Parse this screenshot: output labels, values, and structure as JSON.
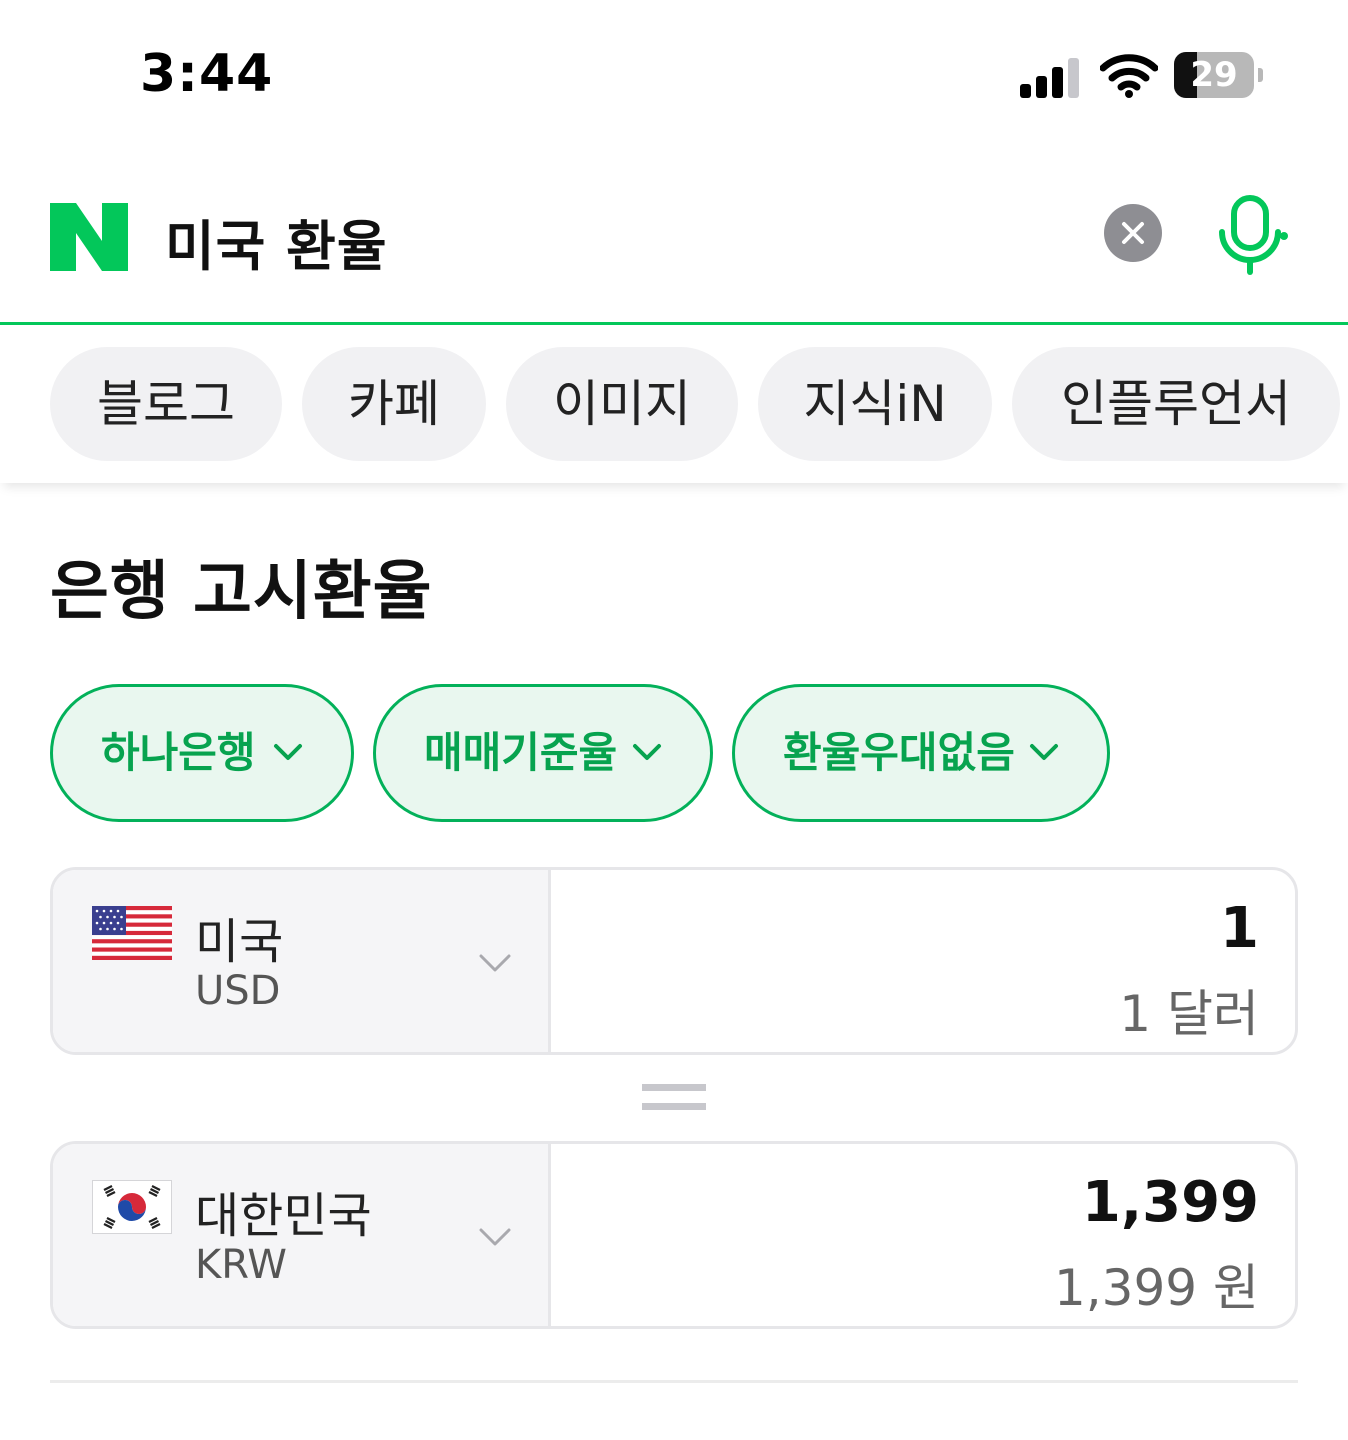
{
  "status_bar": {
    "time": "3:44",
    "battery_level": "29",
    "battery_fraction": 0.29,
    "signal_icon": "cellular-signal-icon",
    "wifi_icon": "wifi-icon"
  },
  "search": {
    "logo": "N",
    "query": "미국 환율",
    "clear_icon": "close-icon",
    "mic_icon": "microphone-icon"
  },
  "tabs": [
    {
      "label": "블로그"
    },
    {
      "label": "카페"
    },
    {
      "label": "이미지"
    },
    {
      "label": "지식iN"
    },
    {
      "label": "인플루언서"
    }
  ],
  "section": {
    "title": "은행 고시환율"
  },
  "filters": [
    {
      "label": "하나은행"
    },
    {
      "label": "매매기준율"
    },
    {
      "label": "환율우대없음"
    }
  ],
  "converter": {
    "from": {
      "country": "미국",
      "code": "USD",
      "amount": "1",
      "amount_text": "1 달러",
      "flag_icon": "us-flag-icon"
    },
    "to": {
      "country": "대한민국",
      "code": "KRW",
      "amount": "1,399",
      "amount_text": "1,399 원",
      "flag_icon": "korea-flag-icon"
    },
    "equals_icon": "equals-icon"
  },
  "colors": {
    "brand_green": "#03c75a",
    "chip_text": "#07a34f",
    "chip_background": "#e9f7ef"
  }
}
